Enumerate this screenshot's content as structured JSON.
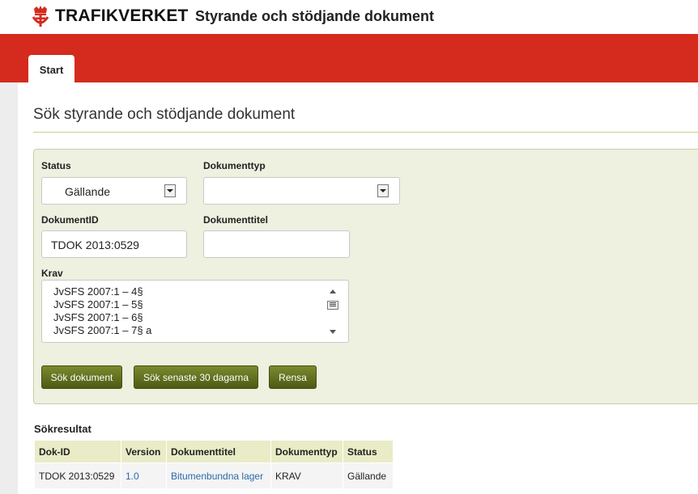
{
  "header": {
    "logo_text": "TRAFIKVERKET",
    "app_title": "Styrande och stödjande dokument"
  },
  "tabs": [
    {
      "label": "Start"
    }
  ],
  "page": {
    "title": "Sök styrande och stödjande dokument"
  },
  "form": {
    "status_label": "Status",
    "status_value": "Gällande",
    "doctype_label": "Dokumenttyp",
    "doctype_value": "",
    "docid_label": "DokumentID",
    "docid_value": "TDOK 2013:0529",
    "doctitle_label": "Dokumenttitel",
    "doctitle_value": "",
    "krav_label": "Krav",
    "krav_options": [
      "JvSFS 2007:1 – 4§",
      "JvSFS 2007:1 – 5§",
      "JvSFS 2007:1 – 6§",
      "JvSFS 2007:1 – 7§ a"
    ]
  },
  "buttons": {
    "search": "Sök dokument",
    "search_30": "Sök senaste 30 dagarna",
    "clear": "Rensa"
  },
  "results": {
    "title": "Sökresultat",
    "columns": [
      "Dok-ID",
      "Version",
      "Dokumenttitel",
      "Dokumenttyp",
      "Status"
    ],
    "rows": [
      [
        "TDOK 2013:0529",
        "1.0",
        "Bitumenbundna lager",
        "KRAV",
        "Gällande"
      ]
    ]
  },
  "colors": {
    "brand_red": "#d42b1e",
    "button_green": "#5d6b1e",
    "link_blue": "#2b6aa9",
    "panel_bg": "#eef0e0"
  }
}
